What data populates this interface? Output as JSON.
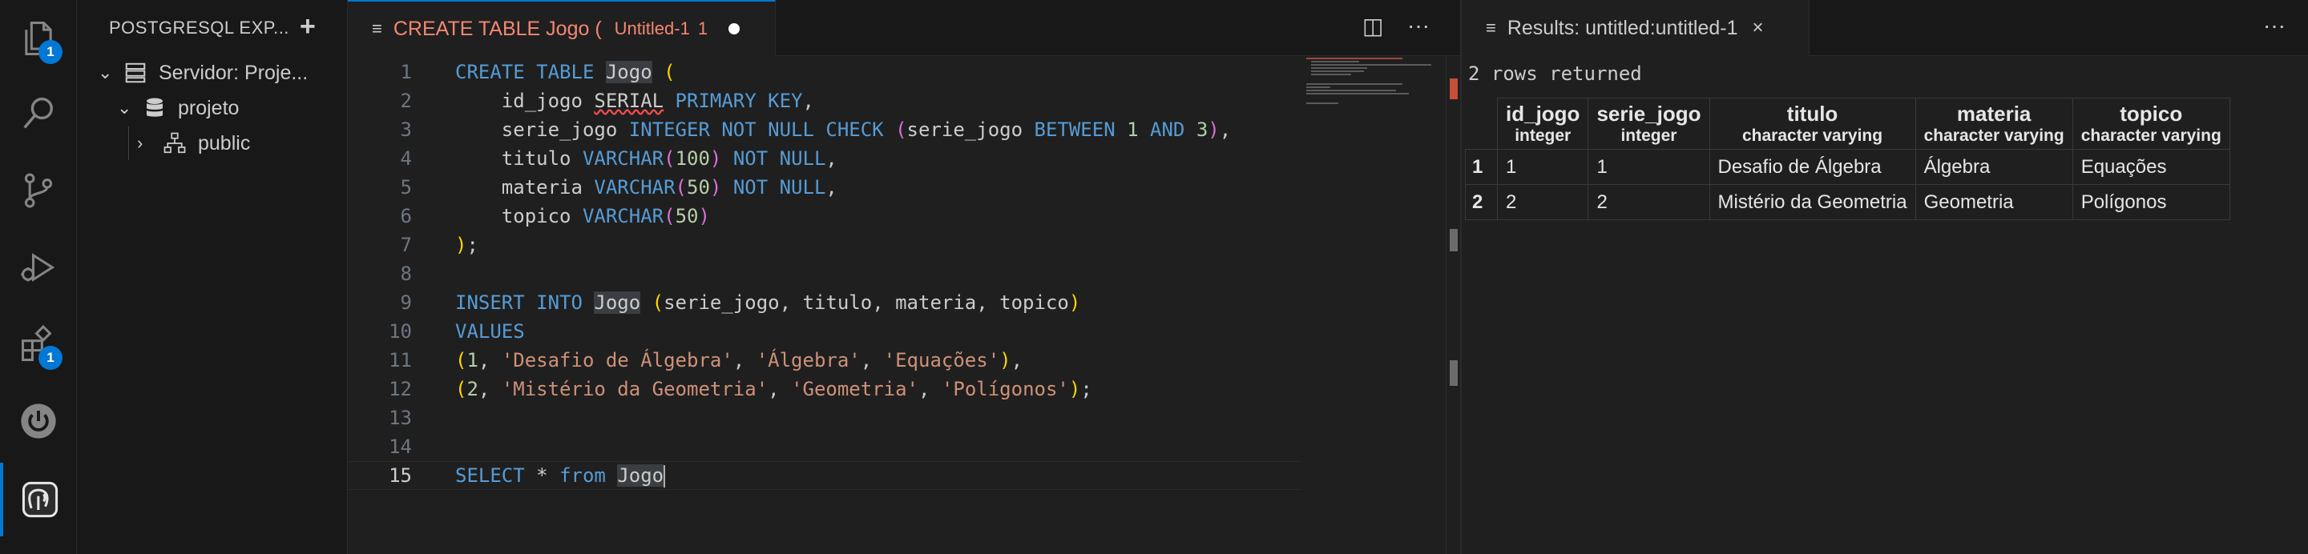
{
  "activity_bar": {
    "items": [
      {
        "icon": "files-icon",
        "badge": "1"
      },
      {
        "icon": "search-icon"
      },
      {
        "icon": "source-control-icon"
      },
      {
        "icon": "run-debug-icon"
      },
      {
        "icon": "extensions-icon",
        "badge": "1"
      },
      {
        "icon": "power-icon"
      },
      {
        "icon": "postgresql-elephant-icon"
      }
    ]
  },
  "sidebar": {
    "title": "POSTGRESQL EXP...",
    "add_label": "+",
    "tree": [
      {
        "label": "Servidor: Proje...",
        "icon": "server-icon",
        "chevron": "⌄"
      },
      {
        "label": "projeto",
        "icon": "database-icon",
        "chevron": "⌄"
      },
      {
        "label": "public",
        "icon": "schema-icon",
        "chevron": "›"
      }
    ]
  },
  "editor": {
    "tab": {
      "title": "CREATE TABLE Jogo (",
      "subtitle": "Untitled-1",
      "problems": "1"
    },
    "actions": {
      "split": "◫",
      "more": "···"
    },
    "active_line": "15",
    "line_numbers": [
      "1",
      "2",
      "3",
      "4",
      "5",
      "6",
      "7",
      "8",
      "9",
      "10",
      "11",
      "12",
      "13",
      "14",
      "15"
    ]
  },
  "results": {
    "tab_title": "Results: untitled:untitled-1",
    "close_label": "×",
    "more_label": "···",
    "rows_returned": "2 rows returned",
    "columns": [
      {
        "name": "id_jogo",
        "type": "integer"
      },
      {
        "name": "serie_jogo",
        "type": "integer"
      },
      {
        "name": "titulo",
        "type": "character varying"
      },
      {
        "name": "materia",
        "type": "character varying"
      },
      {
        "name": "topico",
        "type": "character varying"
      }
    ],
    "rows": [
      {
        "n": "1",
        "cells": [
          "1",
          "1",
          "Desafio de Álgebra",
          "Álgebra",
          "Equações"
        ]
      },
      {
        "n": "2",
        "cells": [
          "2",
          "2",
          "Mistério da Geometria",
          "Geometria",
          "Polígonos"
        ]
      }
    ]
  },
  "colors": {
    "accent": "#0078d4",
    "tab_modified_text": "#f48771",
    "keyword": "#569cd6",
    "string": "#ce9178",
    "number": "#b5cea8"
  }
}
